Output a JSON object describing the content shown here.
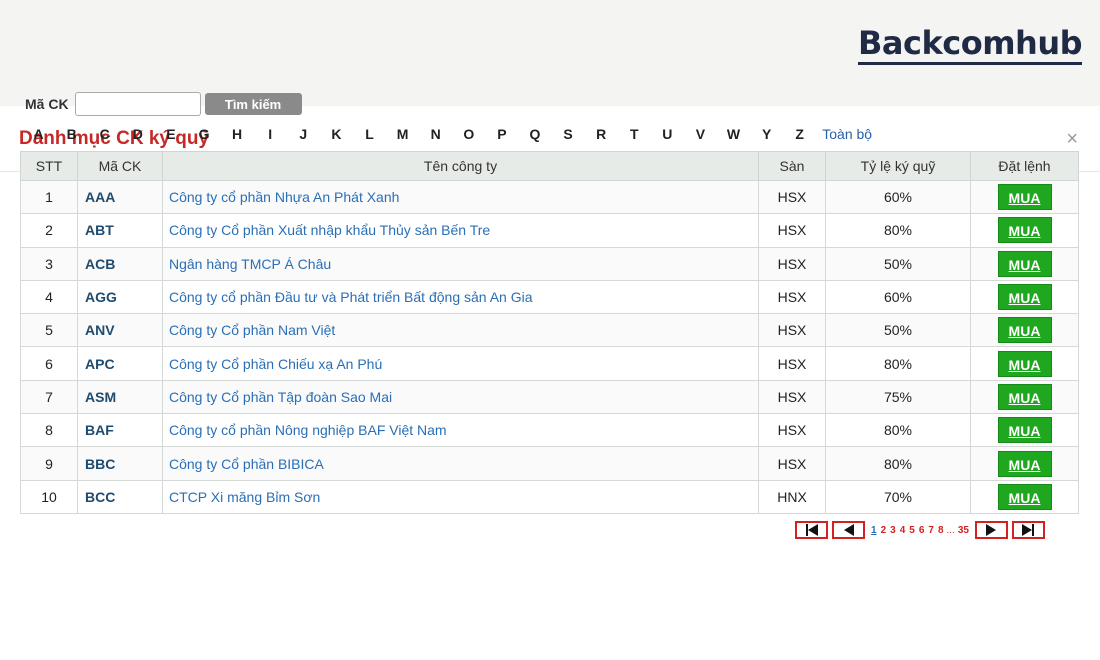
{
  "brand": {
    "logo_text": "Backcomhub"
  },
  "modal": {
    "title": "Danh mục CK ký quỹ",
    "close_glyph": "×"
  },
  "search": {
    "label": "Mã CK",
    "value": "",
    "placeholder": "",
    "button_label": "Tìm kiếm"
  },
  "letters": [
    "A",
    "B",
    "C",
    "D",
    "E",
    "G",
    "H",
    "I",
    "J",
    "K",
    "L",
    "M",
    "N",
    "O",
    "P",
    "Q",
    "S",
    "R",
    "T",
    "U",
    "V",
    "W",
    "Y",
    "Z"
  ],
  "all_label": "Toàn bộ",
  "table": {
    "headers": [
      "STT",
      "Mã CK",
      "Tên công ty",
      "Sàn",
      "Tỷ lệ ký quỹ",
      "Đặt lệnh"
    ],
    "rows": [
      {
        "stt": "1",
        "code": "AAA",
        "name": "Công ty cổ phần Nhựa An Phát Xanh",
        "exchange": "HSX",
        "ratio": "60%",
        "action": "MUA"
      },
      {
        "stt": "2",
        "code": "ABT",
        "name": "Công ty Cổ phần Xuất nhập khẩu Thủy sản Bến Tre",
        "exchange": "HSX",
        "ratio": "80%",
        "action": "MUA"
      },
      {
        "stt": "3",
        "code": "ACB",
        "name": "Ngân hàng TMCP Á Châu",
        "exchange": "HSX",
        "ratio": "50%",
        "action": "MUA"
      },
      {
        "stt": "4",
        "code": "AGG",
        "name": "Công ty cổ phần Đầu tư và Phát triển Bất động sản An Gia",
        "exchange": "HSX",
        "ratio": "60%",
        "action": "MUA"
      },
      {
        "stt": "5",
        "code": "ANV",
        "name": "Công ty Cổ phần Nam Việt",
        "exchange": "HSX",
        "ratio": "50%",
        "action": "MUA"
      },
      {
        "stt": "6",
        "code": "APC",
        "name": "Công ty Cổ phần Chiếu xạ An Phú",
        "exchange": "HSX",
        "ratio": "80%",
        "action": "MUA"
      },
      {
        "stt": "7",
        "code": "ASM",
        "name": "Công ty Cổ phần Tập đoàn Sao Mai",
        "exchange": "HSX",
        "ratio": "75%",
        "action": "MUA"
      },
      {
        "stt": "8",
        "code": "BAF",
        "name": "Công ty cổ phần Nông nghiệp BAF Việt Nam",
        "exchange": "HSX",
        "ratio": "80%",
        "action": "MUA"
      },
      {
        "stt": "9",
        "code": "BBC",
        "name": "Công ty Cổ phần BIBICA",
        "exchange": "HSX",
        "ratio": "80%",
        "action": "MUA"
      },
      {
        "stt": "10",
        "code": "BCC",
        "name": "CTCP Xi măng Bỉm Sơn",
        "exchange": "HNX",
        "ratio": "70%",
        "action": "MUA"
      }
    ]
  },
  "pagination": {
    "pages": [
      "1",
      "2",
      "3",
      "4",
      "5",
      "6",
      "7",
      "8"
    ],
    "current": "1",
    "ellipsis": "...",
    "last": "35"
  },
  "colors": {
    "title_red": "#c62828",
    "buy_green": "#1fa81f",
    "link_blue": "#2a6fb6",
    "pager_red": "#d32020"
  }
}
